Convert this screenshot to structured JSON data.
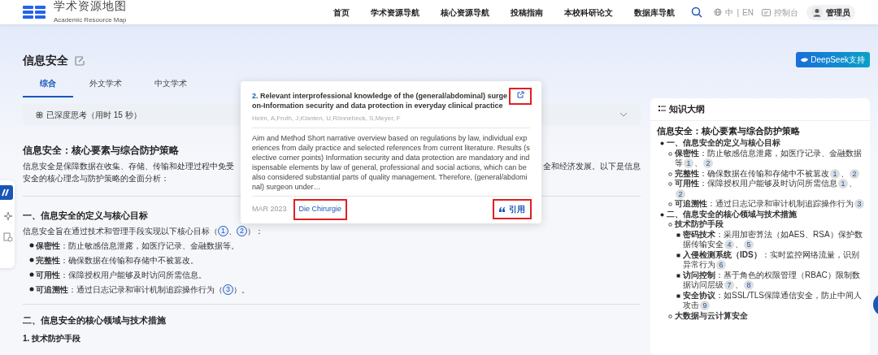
{
  "header": {
    "logo_title": "学术资源地图",
    "logo_subtitle": "Academic Resource Map",
    "nav": [
      {
        "label": "首页",
        "selected": false
      },
      {
        "label": "学术资源导航",
        "selected": false
      },
      {
        "label": "核心资源导航",
        "selected": false
      },
      {
        "label": "投稿指南",
        "selected": false
      },
      {
        "label": "本校科研论文",
        "selected": false
      },
      {
        "label": "数据库导航",
        "selected": false
      }
    ],
    "lang_zh": "中",
    "lang_sep": "|",
    "lang_en": "EN",
    "console": "控制台",
    "user": "管理员"
  },
  "page": {
    "title": "信息安全",
    "deepseek": "DeepSeek支持",
    "tabs": [
      {
        "label": "综合",
        "selected": true
      },
      {
        "label": "外文学术",
        "selected": false
      },
      {
        "label": "中文学术",
        "selected": false
      }
    ],
    "thinking": "已深度思考（用时 15 秒）"
  },
  "article": {
    "heading": "信息安全：核心要素与综合防护策略",
    "intro_left": "信息安全是保障数据在收集、存储、传输和处理过程中免受",
    "intro_right": "全和经济发展。以下是信息",
    "intro_line2": "安全的核心理念与防护策略的全面分析：",
    "section1": "一、信息安全的定义与核心目标",
    "goal_before": "信息安全旨在通过技术和管理手段实现以下核心目标（",
    "goal_cites": [
      "1",
      "2"
    ],
    "goal_sep": "、",
    "goal_after": "）：",
    "bullets": [
      {
        "label": "保密性",
        "text": "：防止敏感信息泄露，如医疗记录、金融数据等。"
      },
      {
        "label": "完整性",
        "text": "：确保数据在传输和存储中不被篡改。"
      },
      {
        "label": "可用性",
        "text": "：保障授权用户能够及时访问所需信息。"
      },
      {
        "label": "可追溯性",
        "text": "：通过日志记录和审计机制追踪操作行为（",
        "cites": [
          "3"
        ],
        "after": "）。"
      }
    ],
    "section2": "二、信息安全的核心领域与技术措施",
    "sub1": "1. 技术防护手段"
  },
  "popup": {
    "number": "2.",
    "title": "Relevant interprofessional knowledge of the (general/abdominal) surgeon-Information security and data protection in everyday clinical practice",
    "authors": "Helm, A,Fruth, J,Klanten, U,Rönnebeck, S,Meyer, F",
    "abstract": "Aim and Method Short narrative overview based on regulations by law, individual experiences from daily practice and selected references from current literature. Results (selective corner points) Information security and data protection are mandatory and indispensable elements by law of general, professional and social actions, which can be also considered substantial parts of quality management. Therefore, (general/abdominal) surgeon under…",
    "date": "MAR 2023",
    "journal": "Die Chirurgie",
    "cite": "引用",
    "link_highlighted": true,
    "journal_highlighted": true,
    "cite_highlighted": true
  },
  "outline": {
    "title": "知识大纲",
    "heading": "信息安全：核心要素与综合防护策略",
    "cite_sep": "、",
    "items": [
      {
        "label": "一、信息安全的定义与核心目标",
        "children": [
          {
            "label": "保密性",
            "text": "：防止敏感信息泄露，如医疗记录、金融数据等",
            "cites": [
              "1",
              "2"
            ]
          },
          {
            "label": "完整性",
            "text": "：确保数据在传输和存储中不被篡改",
            "cites": [
              "1",
              "2"
            ]
          },
          {
            "label": "可用性",
            "text": "：保障授权用户能够及时访问所需信息",
            "cites": [
              "1",
              "2"
            ]
          },
          {
            "label": "可追溯性",
            "text": "：通过日志记录和审计机制追踪操作行为",
            "cites": [
              "3"
            ]
          }
        ]
      },
      {
        "label": "二、信息安全的核心领域与技术措施",
        "children": [
          {
            "label": "技术防护手段",
            "children": [
              {
                "label": "密码技术",
                "text": "：采用加密算法（如AES、RSA）保护数据传输安全",
                "cites": [
                  "4",
                  "5"
                ]
              },
              {
                "label": "入侵检测系统（IDS）",
                "text": "：实时监控网络流量，识别异常行为",
                "cites": [
                  "6"
                ]
              },
              {
                "label": "访问控制",
                "text": "：基于角色的权限管理（RBAC）限制数据访问层级",
                "cites": [
                  "7",
                  "8"
                ]
              },
              {
                "label": "安全协议",
                "text": "：如SSL/TLS保障通信安全，防止中间人攻击",
                "cites": [
                  "9"
                ]
              }
            ]
          },
          {
            "label": "大数据与云计算安全"
          }
        ]
      }
    ]
  }
}
